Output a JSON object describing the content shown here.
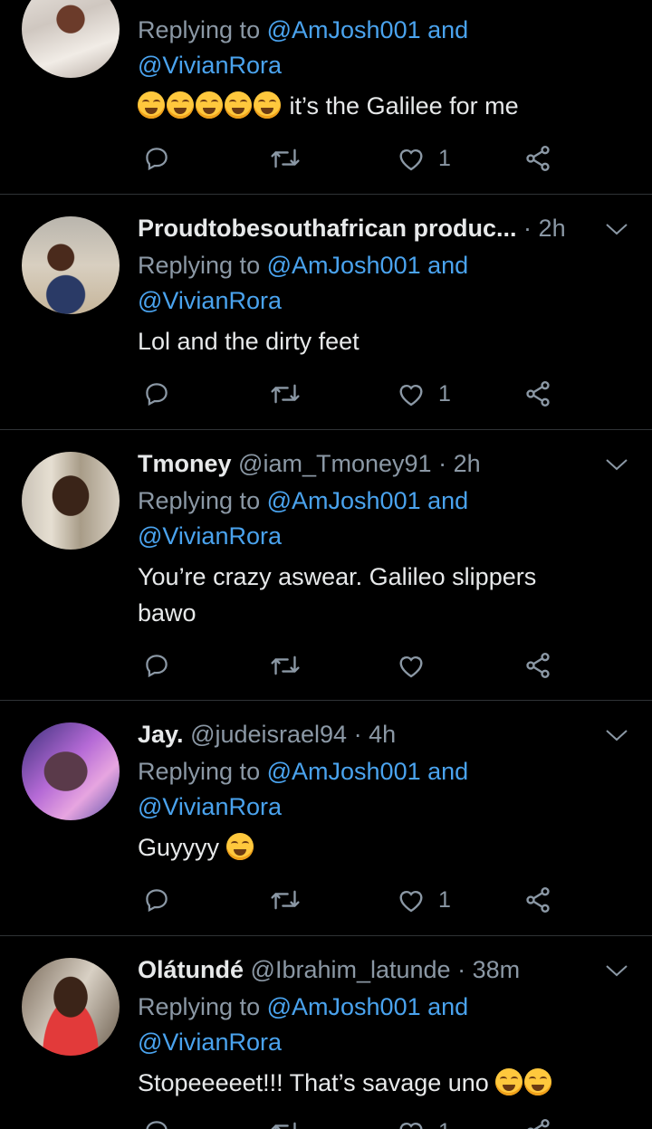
{
  "replying_prefix": "Replying to",
  "and_word": "and",
  "mention_1": "@AmJosh001",
  "mention_2": "@VivianRora",
  "separator": "·",
  "tweets": [
    {
      "name": "",
      "handle": "",
      "time": "",
      "body": "it’s the Galilee for me",
      "emoji_count": 5,
      "like_count": "1"
    },
    {
      "name": "Proudtobesouthafrican produc...",
      "handle": "",
      "time": "2h",
      "body": "Lol and the dirty feet",
      "like_count": "1"
    },
    {
      "name": "Tmoney",
      "handle": "@iam_Tmoney91",
      "time": "2h",
      "body": "You’re crazy aswear. Galileo slippers bawo",
      "like_count": ""
    },
    {
      "name": "Jay.",
      "handle": "@judeisrael94",
      "time": "4h",
      "body": "Guyyyy",
      "like_count": "1"
    },
    {
      "name": "Olátundé",
      "handle": "@Ibrahim_latunde",
      "time": "38m",
      "body": "Stopeeeeet!!! That’s savage uno",
      "like_count": "1"
    }
  ],
  "colors": {
    "background": "#000000",
    "mention": "#4aa3ee",
    "muted": "#8b98a5",
    "text": "#e7e9ea",
    "divider": "#2f3336"
  },
  "icons": [
    "reply-icon",
    "retweet-icon",
    "like-icon",
    "share-icon",
    "chevron-down-icon"
  ]
}
